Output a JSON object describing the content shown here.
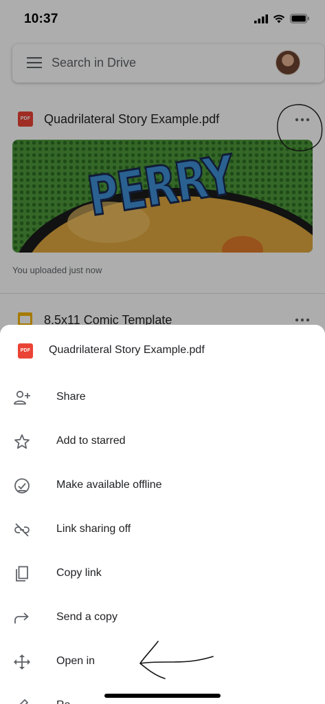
{
  "status_bar": {
    "time": "10:37"
  },
  "search": {
    "placeholder": "Search in Drive"
  },
  "files": [
    {
      "title": "Quadrilateral Story Example.pdf",
      "type_badge": "PDF",
      "thumbnail_text": "PERRY",
      "subtitle": "You uploaded just now"
    },
    {
      "title": "8.5x11 Comic Template"
    }
  ],
  "sheet": {
    "file_title": "Quadrilateral Story Example.pdf",
    "file_badge": "PDF",
    "items": [
      {
        "label": "Share",
        "icon": "add-person-icon"
      },
      {
        "label": "Add to starred",
        "icon": "star-icon"
      },
      {
        "label": "Make available offline",
        "icon": "offline-check-icon"
      },
      {
        "label": "Link sharing off",
        "icon": "link-off-icon"
      },
      {
        "label": "Copy link",
        "icon": "copy-icon"
      },
      {
        "label": "Send a copy",
        "icon": "send-arrow-icon"
      },
      {
        "label": "Open in",
        "icon": "move-arrows-icon"
      },
      {
        "label": "Re",
        "icon": "pencil-icon"
      }
    ]
  },
  "colors": {
    "pdf_red": "#ea4335",
    "doc_yellow": "#f4b400",
    "thumb_green": "#4f9a3b",
    "scrim": "rgba(0,0,0,0.32)"
  }
}
